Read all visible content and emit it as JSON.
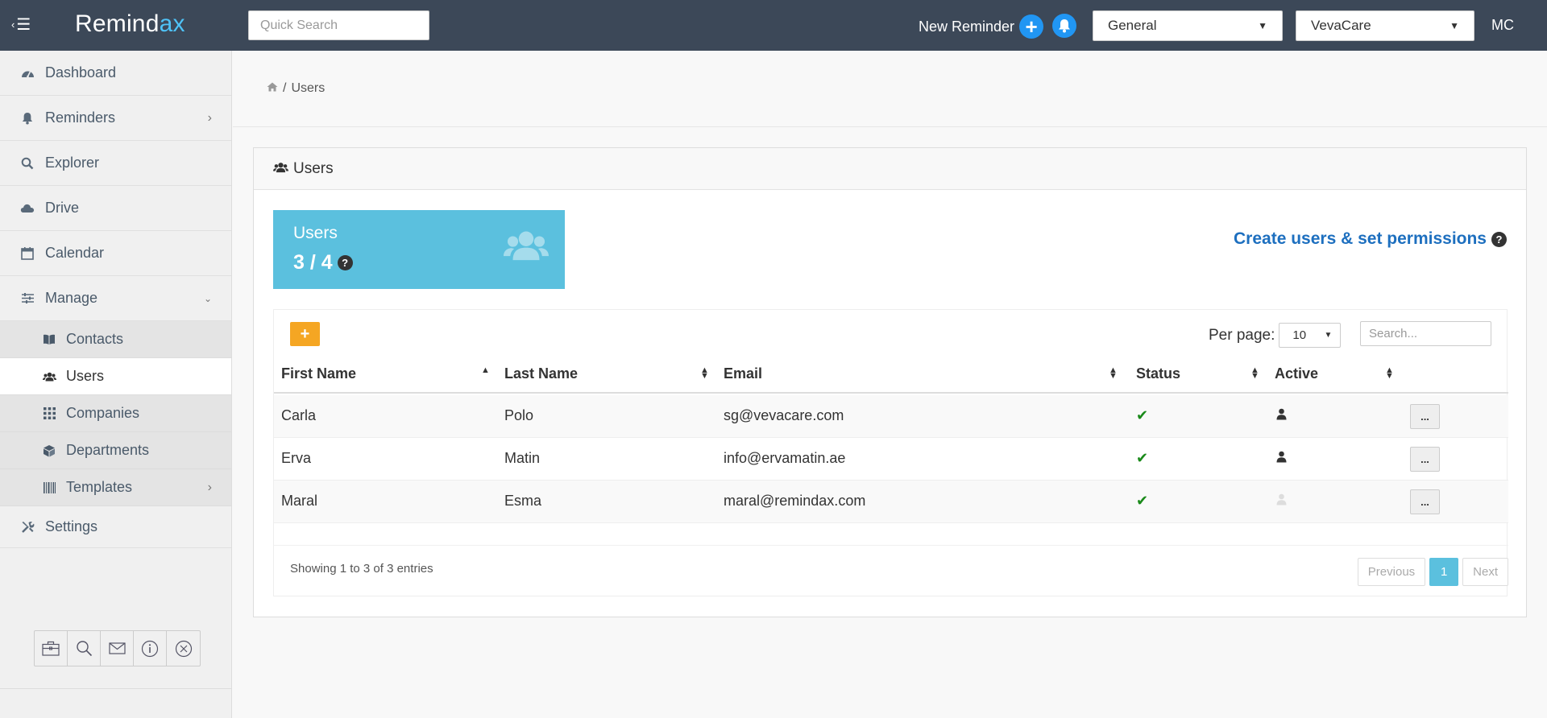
{
  "topbar": {
    "logo_text": "Remind",
    "logo_accent": "ax",
    "quick_search_placeholder": "Quick Search",
    "new_reminder_label": "New Reminder",
    "workspace_select": "General",
    "company_select": "VevaCare",
    "user_initials": "MC"
  },
  "sidebar": {
    "items": [
      {
        "label": "Dashboard"
      },
      {
        "label": "Reminders"
      },
      {
        "label": "Explorer"
      },
      {
        "label": "Drive"
      },
      {
        "label": "Calendar"
      },
      {
        "label": "Manage"
      }
    ],
    "manage_sub": [
      {
        "label": "Contacts"
      },
      {
        "label": "Users"
      },
      {
        "label": "Companies"
      },
      {
        "label": "Departments"
      },
      {
        "label": "Templates"
      }
    ],
    "settings_label": "Settings"
  },
  "breadcrumb": {
    "separator": "/",
    "current": "Users"
  },
  "panel": {
    "title": "Users",
    "stat_label": "Users",
    "stat_value": "3 / 4",
    "create_link": "Create users & set permissions",
    "per_page_label": "Per page:",
    "per_page_value": "10",
    "search_placeholder": "Search...",
    "columns": [
      "First Name",
      "Last Name",
      "Email",
      "Status",
      "Active"
    ],
    "rows": [
      {
        "first": "Carla",
        "last": "Polo",
        "email": "sg@vevacare.com",
        "active": true
      },
      {
        "first": "Erva",
        "last": "Matin",
        "email": "info@ervamatin.ae",
        "active": true
      },
      {
        "first": "Maral",
        "last": "Esma",
        "email": "maral@remindax.com",
        "active": false
      }
    ],
    "more_label": "...",
    "showing_text": "Showing 1 to 3 of 3 entries",
    "pager": {
      "previous": "Previous",
      "page": "1",
      "next": "Next"
    }
  },
  "colors": {
    "topbar": "#3c4858",
    "accent_blue": "#2196f3",
    "stat_box": "#5bc0de",
    "add_button": "#f5a623",
    "link": "#1d6fbf",
    "check": "#1a8a1a"
  }
}
